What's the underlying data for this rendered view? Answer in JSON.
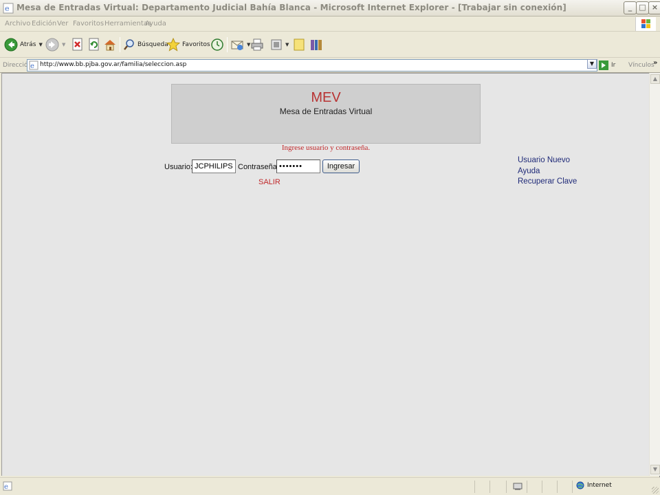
{
  "window": {
    "title": "Mesa de Entradas Virtual: Departamento Judicial Bahía Blanca - Microsoft Internet Explorer - [Trabajar sin conexión]"
  },
  "menu": [
    "Archivo",
    "Edición",
    "Ver",
    "Favoritos",
    "Herramientas",
    "Ayuda"
  ],
  "toolbar": {
    "back_label": "Atrás",
    "search_label": "Búsqueda",
    "favorites_label": "Favoritos"
  },
  "address": {
    "label": "Dirección",
    "url": "http://www.bb.pjba.gov.ar/familia/seleccion.asp",
    "go_label": "Ir",
    "links_label": "Vínculos"
  },
  "page": {
    "title": "MEV",
    "subtitle": "Mesa de Entradas Virtual",
    "login_message": "Ingrese usuario y contraseña.",
    "user_label": "Usuario:",
    "user_value": "JCPHILIPS",
    "password_label": "Contraseña:",
    "password_value": "•••••••",
    "submit_label": "Ingresar",
    "exit_label": "SALIR",
    "links": [
      "Usuario Nuevo",
      "Ayuda",
      "Recuperar Clave"
    ]
  },
  "status": {
    "zone_label": "Internet"
  },
  "colors": {
    "accent_red": "#b83232",
    "link_blue": "#1f2a78",
    "page_bg": "#e6e6e6",
    "header_bg": "#cfcfcf"
  }
}
